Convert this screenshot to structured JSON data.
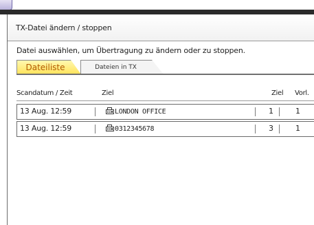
{
  "window": {
    "title": "TX-Datei ändern / stoppen",
    "instruction": "Datei auswählen, um Übertragung zu ändern oder zu stoppen."
  },
  "tabs": [
    {
      "label": "Dateiliste",
      "active": true
    },
    {
      "label": "Dateien in TX",
      "active": false
    }
  ],
  "table": {
    "headers": {
      "date_time": "Scandatum / Zeit",
      "destination": "Ziel",
      "dest_count": "Ziel",
      "progress": "Vorl."
    },
    "rows": [
      {
        "date_time": "13 Aug. 12:59",
        "destination_icon": "fax-icon",
        "destination": "LONDON OFFICE",
        "dest_count": "1",
        "progress": "1"
      },
      {
        "date_time": "13 Aug. 12:59",
        "destination_icon": "fax-icon",
        "destination": "0312345678",
        "dest_count": "3",
        "progress": "1"
      }
    ]
  },
  "colors": {
    "active_tab_bg": "#ffe35a",
    "active_tab_text": "#b35a00",
    "top_strip": "#2a2a2a"
  }
}
